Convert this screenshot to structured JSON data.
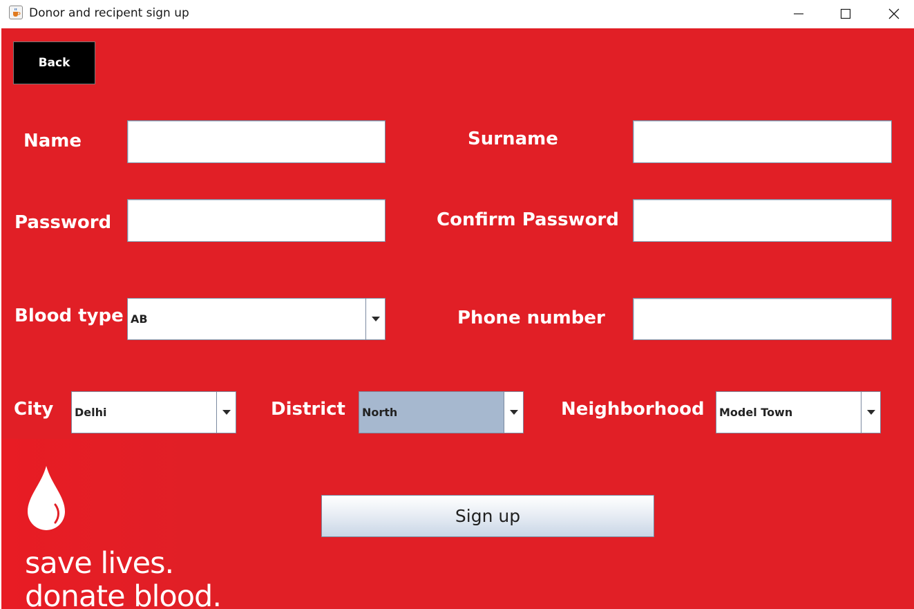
{
  "window": {
    "title": "Donor and recipent sign up",
    "icon": "java-cup-icon",
    "controls": [
      "minimize-icon",
      "maximize-icon",
      "close-icon"
    ]
  },
  "colors": {
    "background": "#e11f26",
    "back_button": "#000000",
    "label_text": "#ffffff",
    "highlighted_combo": "#a6b8cf"
  },
  "back_button": {
    "label": "Back"
  },
  "form": {
    "name": {
      "label": "Name",
      "value": ""
    },
    "surname": {
      "label": "Surname",
      "value": ""
    },
    "password": {
      "label": "Password",
      "value": ""
    },
    "confirm_password": {
      "label": "Confirm Password",
      "value": ""
    },
    "blood_type": {
      "label": "Blood type",
      "selected": "AB"
    },
    "phone_number": {
      "label": "Phone number",
      "value": ""
    },
    "city": {
      "label": "City",
      "selected": "Delhi"
    },
    "district": {
      "label": "District",
      "selected": "North"
    },
    "neighborhood": {
      "label": "Neighborhood",
      "selected": "Model Town"
    }
  },
  "signup_button": {
    "label": "Sign up"
  },
  "logo": {
    "icon": "blood-drop-icon",
    "line1": "save lives.",
    "line2": "donate blood."
  }
}
